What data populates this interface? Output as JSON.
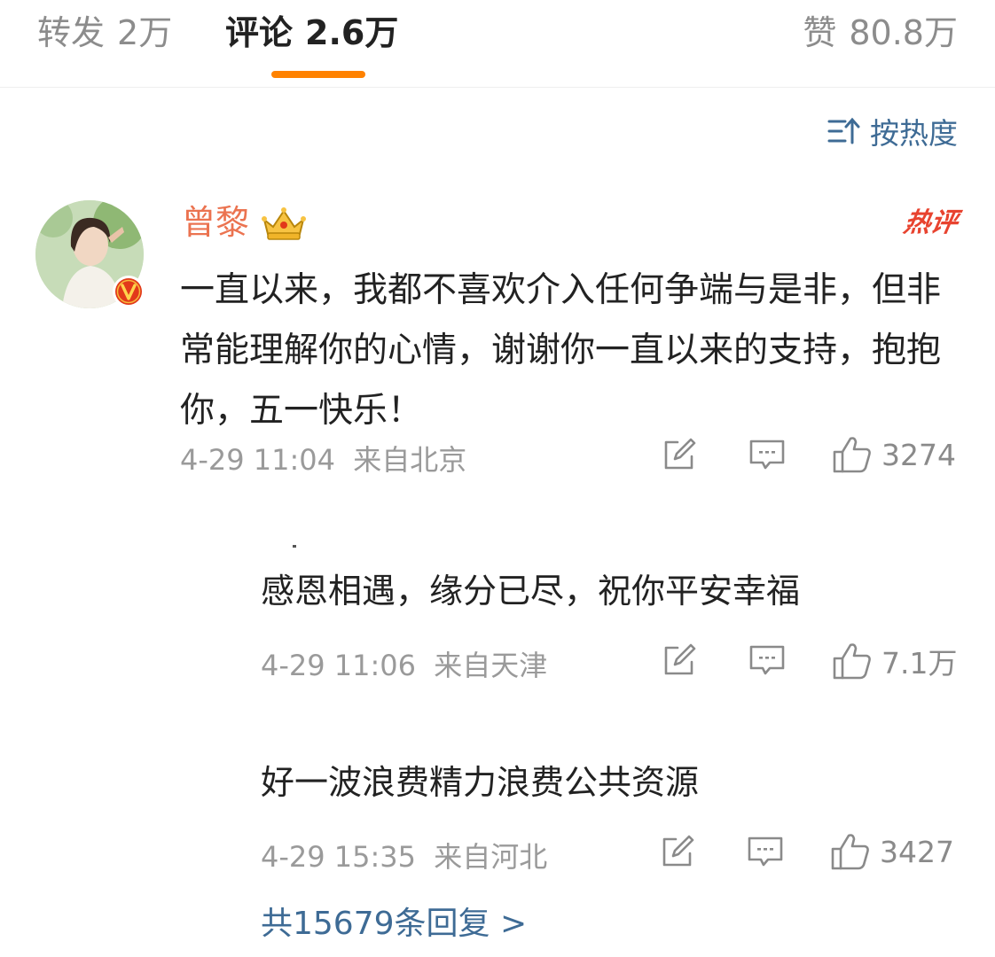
{
  "tabs": {
    "repost": {
      "label": "转发",
      "count": "2万"
    },
    "comment": {
      "label": "评论",
      "count": "2.6万"
    },
    "like": {
      "label": "赞",
      "count": "80.8万"
    }
  },
  "sort": {
    "label": "按热度"
  },
  "comment": {
    "username": "曾黎",
    "hot_badge": "热评",
    "text": "一直以来，我都不喜欢介入任何争端与是非，但非常能理解你的心情，谢谢你一直以来的支持，抱抱你，五一快乐！",
    "time": "4-29 11:04",
    "source": "来自北京",
    "likes": "3274"
  },
  "replies": [
    {
      "text": "感恩相遇，缘分已尽，祝你平安幸福",
      "time": "4-29 11:06",
      "source": "来自天津",
      "likes": "7.1万"
    },
    {
      "text": "好一波浪费精力浪费公共资源",
      "time": "4-29 15:35",
      "source": "来自河北",
      "likes": "3427"
    }
  ],
  "more_replies": "共15679条回复 >",
  "colors": {
    "accent": "#ff8200",
    "username": "#eb7350",
    "link": "#3e6b95",
    "hot": "#e8432f"
  },
  "icons": [
    "sort-icon",
    "vip-v-icon",
    "crown-icon",
    "repost-icon",
    "comment-icon",
    "like-icon"
  ]
}
